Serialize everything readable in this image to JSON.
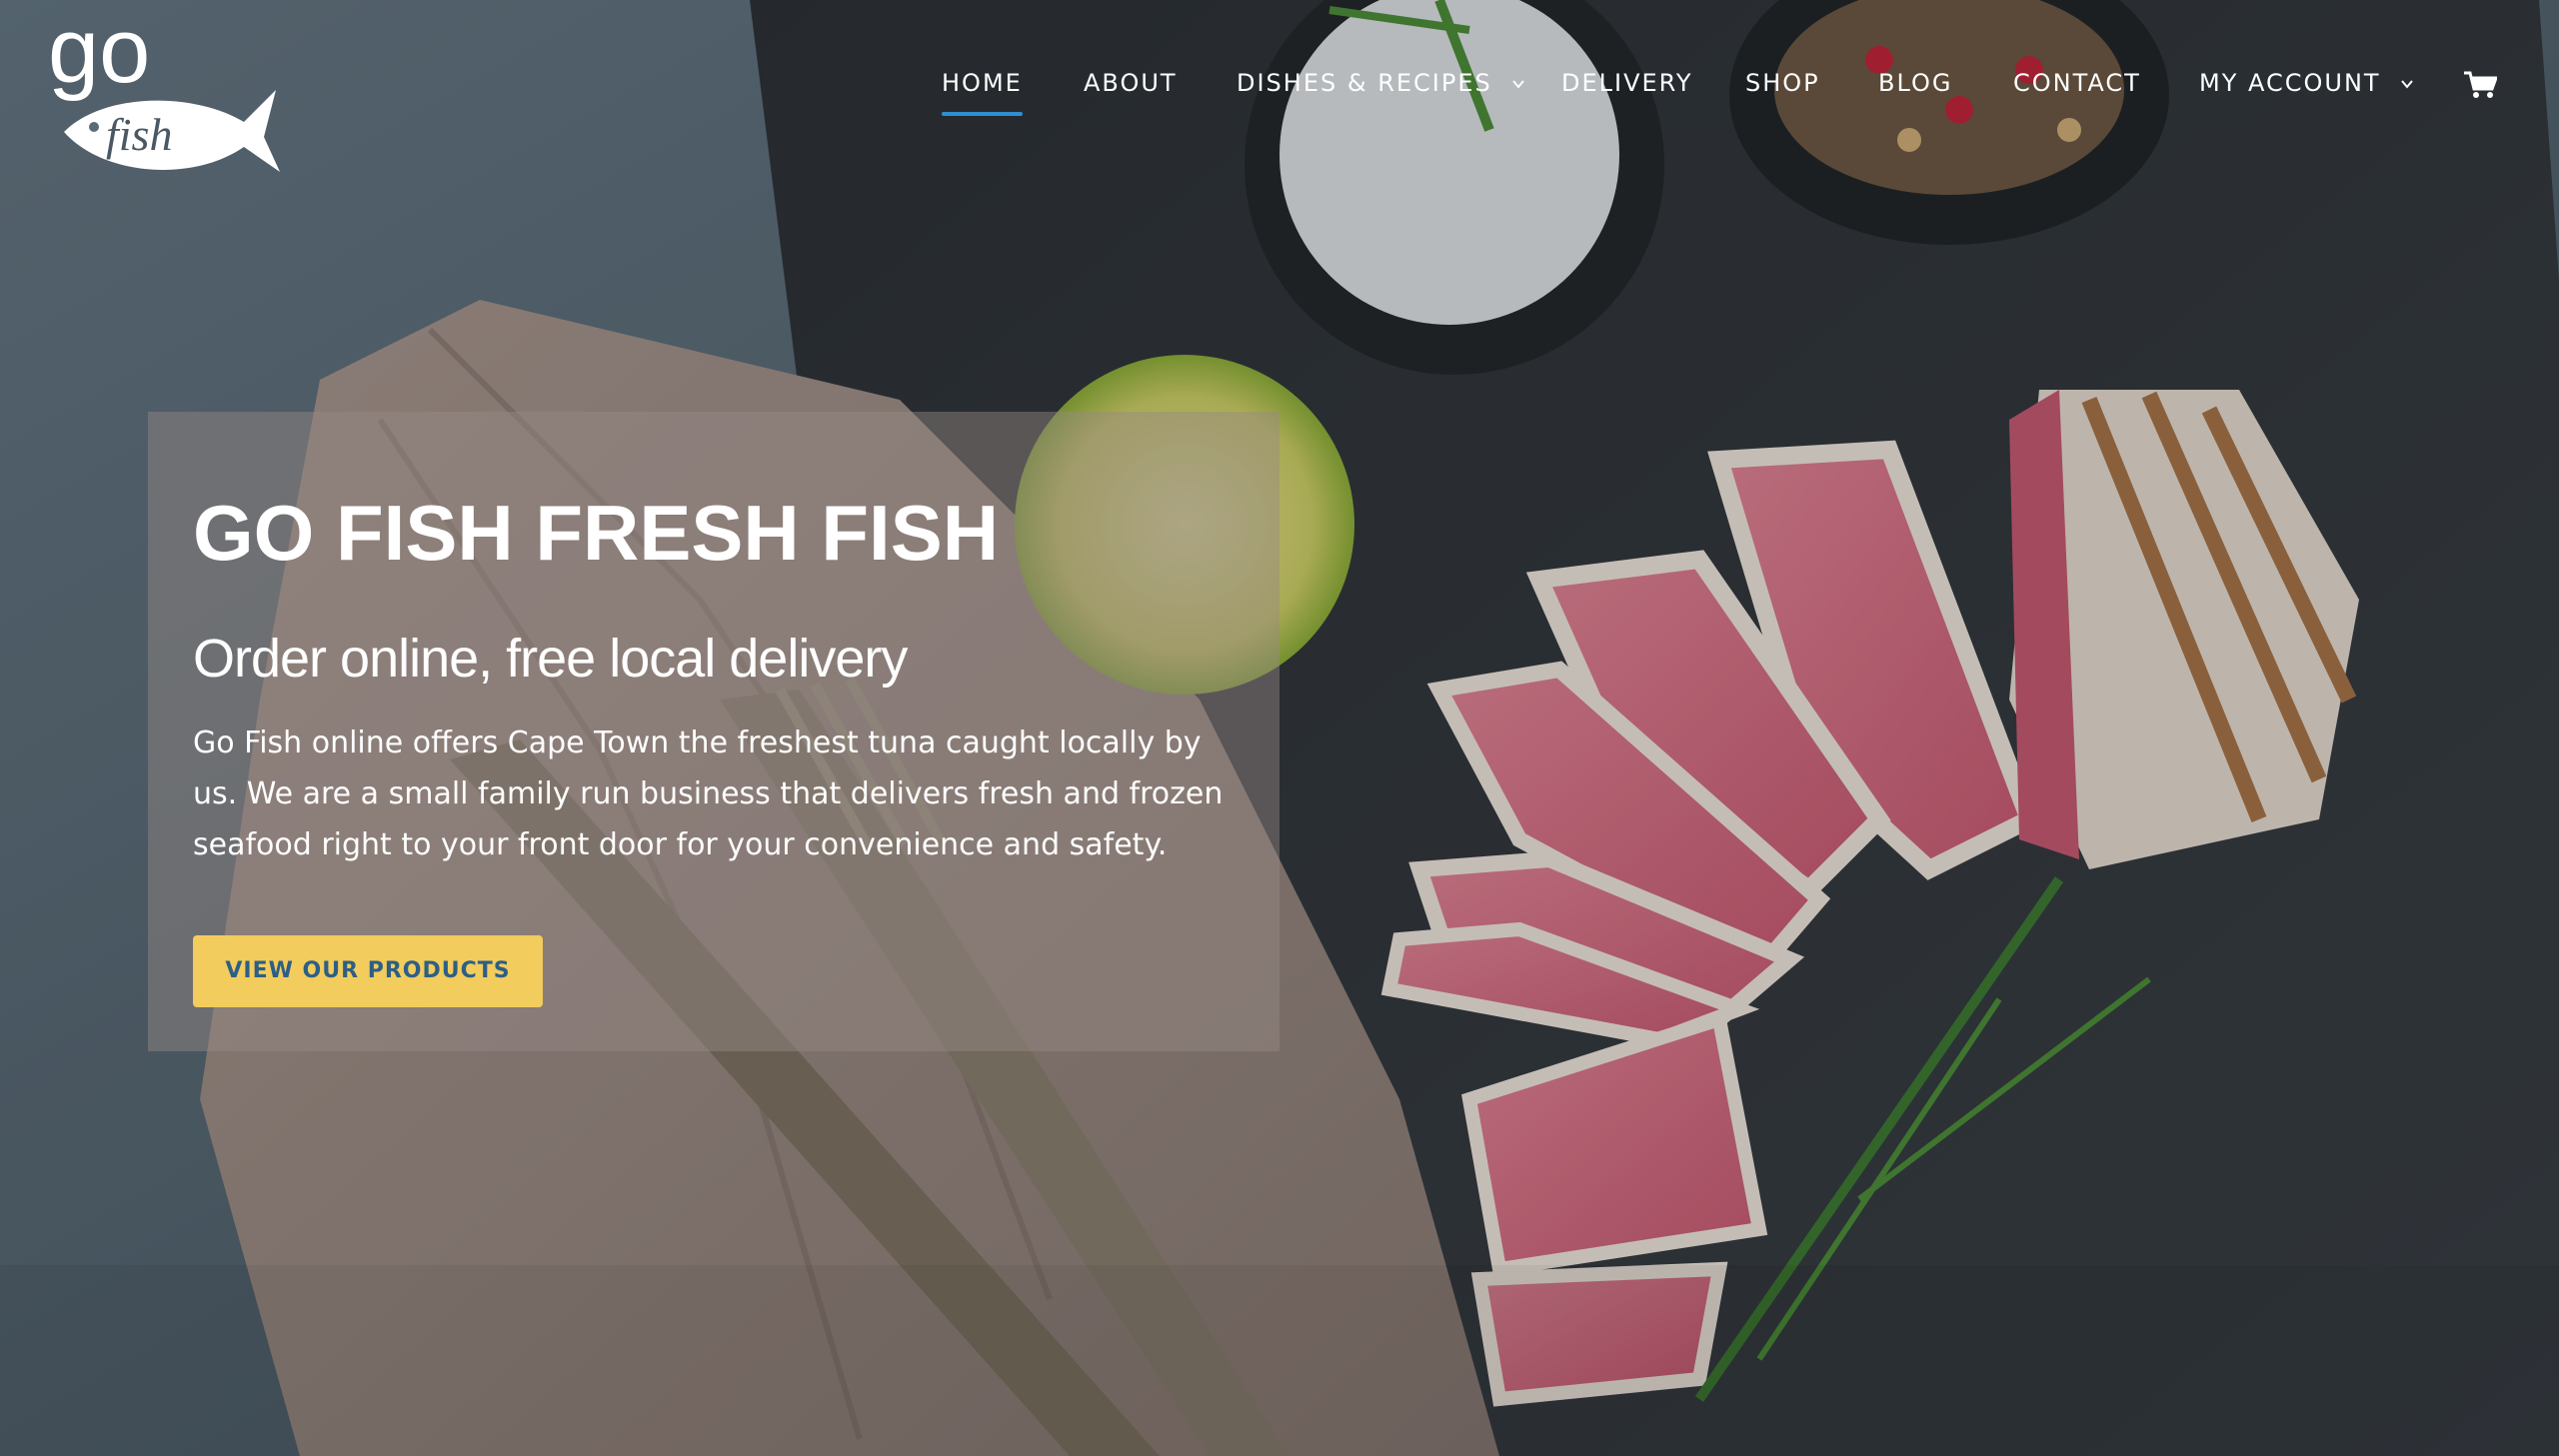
{
  "header": {
    "logo_text_top": "go",
    "logo_text_fish": "fish",
    "nav": [
      {
        "label": "HOME",
        "active": true,
        "has_dropdown": false
      },
      {
        "label": "ABOUT",
        "active": false,
        "has_dropdown": false
      },
      {
        "label": "DISHES & RECIPES",
        "active": false,
        "has_dropdown": true
      },
      {
        "label": "DELIVERY",
        "active": false,
        "has_dropdown": false
      },
      {
        "label": "SHOP",
        "active": false,
        "has_dropdown": false
      },
      {
        "label": "BLOG",
        "active": false,
        "has_dropdown": false
      },
      {
        "label": "CONTACT",
        "active": false,
        "has_dropdown": false
      },
      {
        "label": "MY ACCOUNT",
        "active": false,
        "has_dropdown": true
      }
    ],
    "cart_icon": "shopping-cart-icon"
  },
  "hero": {
    "title": "GO FISH FRESH FISH",
    "subtitle": "Order online, free local delivery",
    "body": "Go Fish online offers Cape Town the freshest tuna caught locally by us. We are a small family run business that delivers fresh and frozen seafood right to your front door for your convenience and safety.",
    "button_label": "VIEW OUR PRODUCTS"
  },
  "colors": {
    "accent_underline": "#2f8fd0",
    "button_bg": "#f2cc5c",
    "button_text": "#2d5f86",
    "nav_text": "#ffffff"
  },
  "icons": [
    "chevron-down-icon",
    "shopping-cart-icon"
  ]
}
